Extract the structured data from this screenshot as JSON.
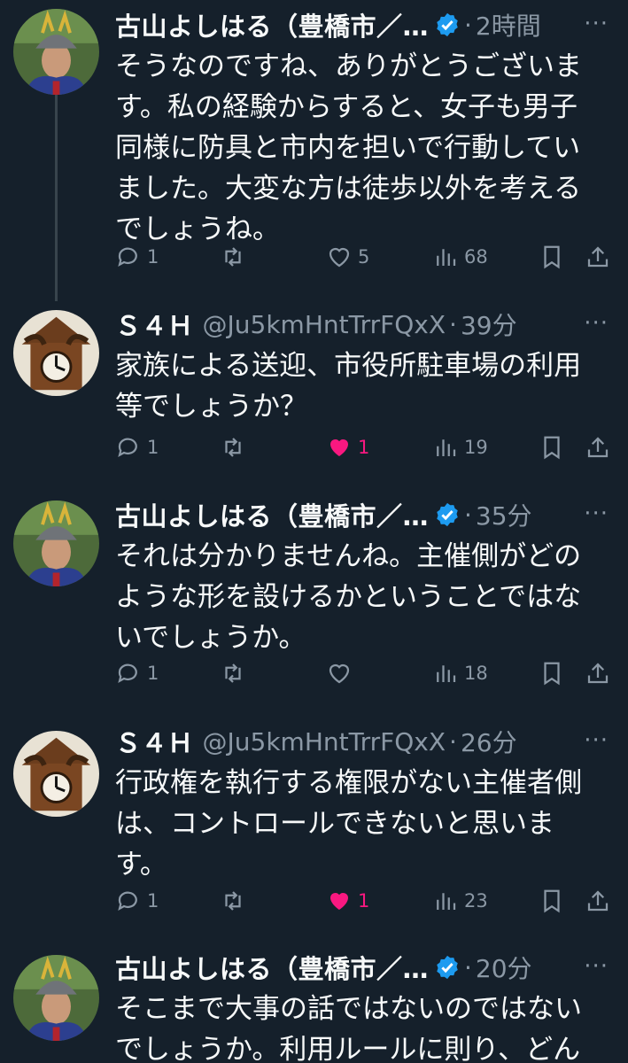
{
  "tweets": [
    {
      "name": "古山よしはる（豊橋市／…",
      "handle": "",
      "verified": true,
      "time": "2時間",
      "avatar": "samurai-helmet-avatar",
      "text": "そうなのですね、ありがとうございます。私の経験からすると、女子も男子同様に防具と市内を担いで行動していました。大変な方は徒歩以外を考えるでしょうね。",
      "replies": "1",
      "retweets": "",
      "likes": "5",
      "liked": false,
      "views": "68"
    },
    {
      "name": "Ｓ４Ｈ",
      "handle": "@Ju5kmHntTrrFQxX",
      "verified": false,
      "time": "39分",
      "avatar": "cuckoo-clock-avatar",
      "text": "家族による送迎、市役所駐車場の利用等でしょうか？",
      "replies": "1",
      "retweets": "",
      "likes": "1",
      "liked": true,
      "views": "19"
    },
    {
      "name": "古山よしはる（豊橋市／…",
      "handle": "",
      "verified": true,
      "time": "35分",
      "avatar": "samurai-helmet-avatar",
      "text": "それは分かりませんね。主催側がどのような形を設けるかということではないでしょうか。",
      "replies": "1",
      "retweets": "",
      "likes": "",
      "liked": false,
      "views": "18"
    },
    {
      "name": "Ｓ４Ｈ",
      "handle": "@Ju5kmHntTrrFQxX",
      "verified": false,
      "time": "26分",
      "avatar": "cuckoo-clock-avatar",
      "text": "行政権を執行する権限がない主催者側は、コントロールできないと思います。",
      "replies": "1",
      "retweets": "",
      "likes": "1",
      "liked": true,
      "views": "23"
    },
    {
      "name": "古山よしはる（豊橋市／…",
      "handle": "",
      "verified": true,
      "time": "20分",
      "avatar": "samurai-helmet-avatar",
      "text": "そこまで大事の話ではないのではないでしょうか。利用ルールに則り、どん",
      "replies": "",
      "retweets": "",
      "likes": "",
      "liked": false,
      "views": ""
    }
  ],
  "separator": "·",
  "more_icon": "···",
  "colors": {
    "background": "#15202b",
    "text": "#f7f9f9",
    "muted": "#8b98a5",
    "like": "#f91880",
    "verified": "#1d9bf0"
  }
}
